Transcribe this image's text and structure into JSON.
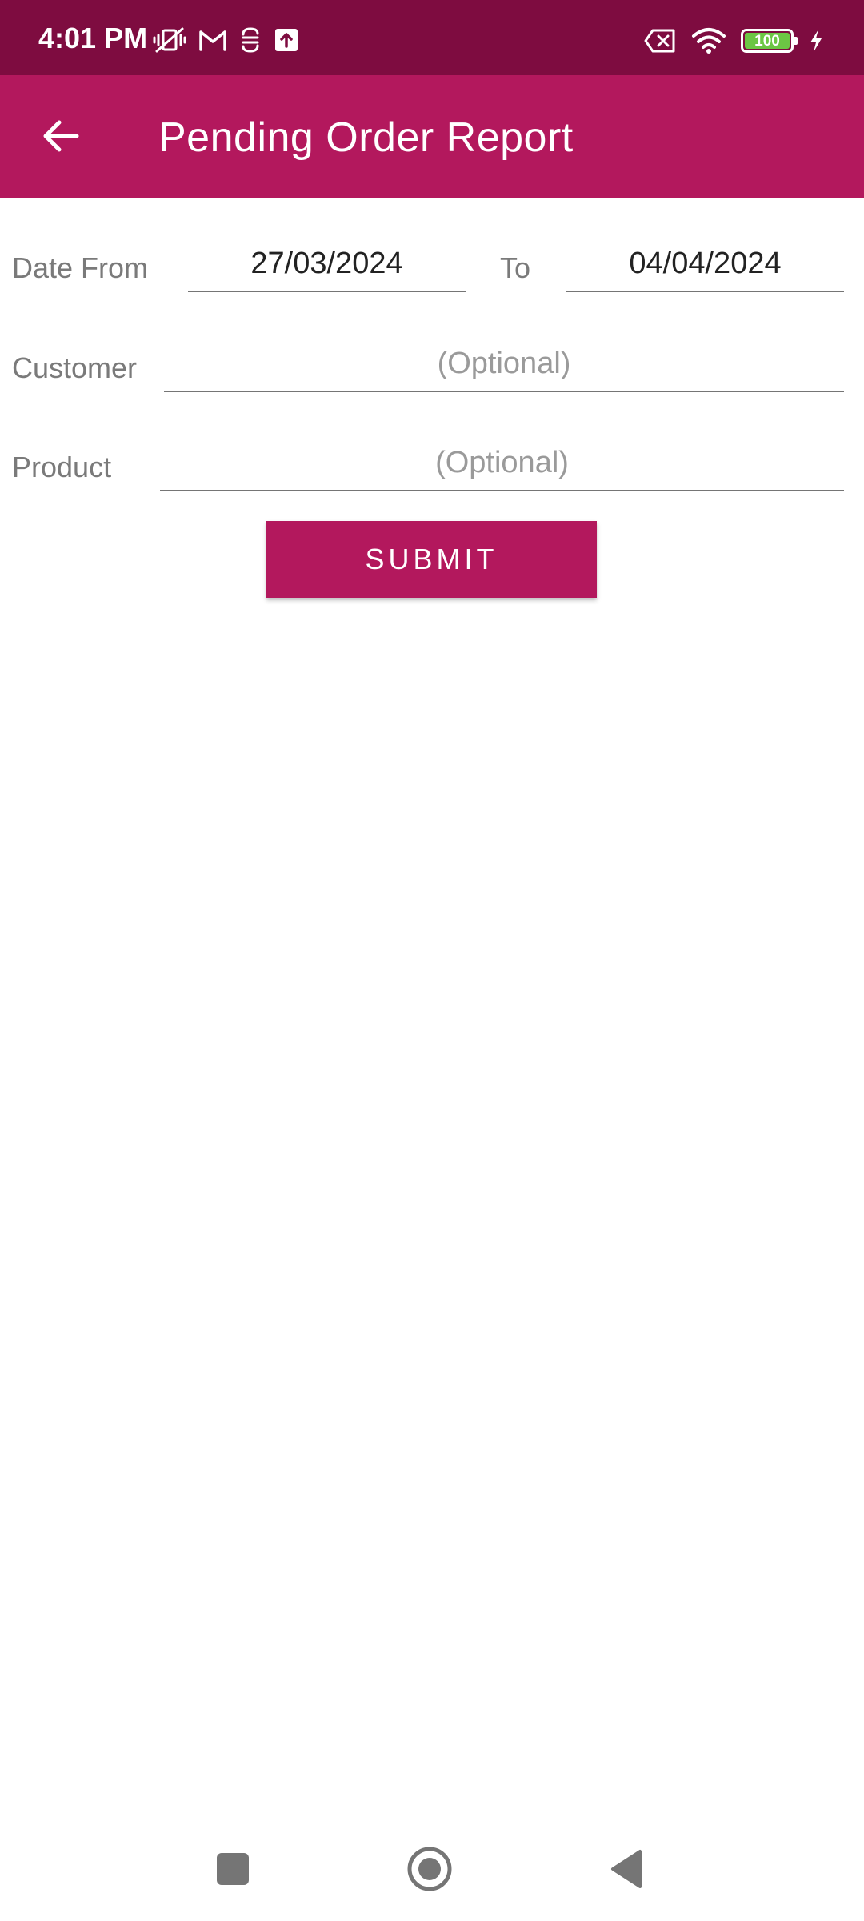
{
  "status_bar": {
    "time": "4:01 PM",
    "battery_level": "100",
    "icons": [
      "vibrate-off-icon",
      "gmail-icon",
      "sync-icon",
      "upload-icon",
      "sim-off-icon",
      "wifi-icon",
      "battery-icon",
      "charging-icon"
    ]
  },
  "app_bar": {
    "title": "Pending Order Report",
    "back_icon": "arrow-left-icon"
  },
  "form": {
    "date_from_label": "Date From",
    "date_from_value": "27/03/2024",
    "to_label": "To",
    "date_to_value": "04/04/2024",
    "customer_label": "Customer",
    "customer_placeholder": "(Optional)",
    "customer_value": "",
    "product_label": "Product",
    "product_placeholder": "(Optional)",
    "product_value": "",
    "submit_label": "SUBMIT"
  },
  "nav_bar": {
    "icons": [
      "recents-square-icon",
      "home-circle-icon",
      "back-triangle-icon"
    ]
  },
  "colors": {
    "status_bar": "#7e0c40",
    "primary": "#b3185d",
    "label_text": "#7a7a7a",
    "placeholder_text": "#9a9a9a"
  }
}
